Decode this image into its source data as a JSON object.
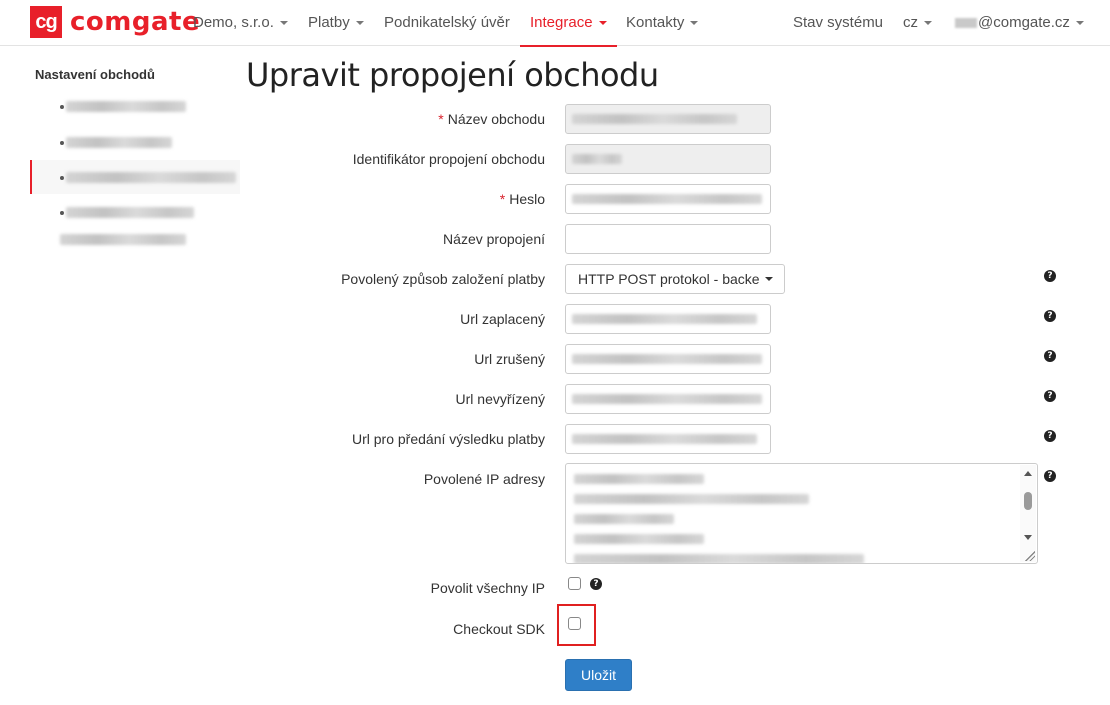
{
  "brand": {
    "logo_mark": "cg",
    "logo_text": "comgate",
    "accent": "#e8202a"
  },
  "navbar": {
    "company": "Demo, s.r.o.",
    "payments": "Platby",
    "loan": "Podnikatelský úvěr",
    "integration": "Integrace",
    "contacts": "Kontakty",
    "system_status": "Stav systému",
    "language": "cz",
    "user_email": "@comgate.cz"
  },
  "sidebar": {
    "title": "Nastavení obchodů"
  },
  "page": {
    "title": "Upravit propojení obchodu"
  },
  "form": {
    "required_mark": "*",
    "shop_name_label": "Název obchodu",
    "connection_id_label": "Identifikátor propojení obchodu",
    "password_label": "Heslo",
    "connection_name_label": "Název propojení",
    "payment_method_label": "Povolený způsob založení platby",
    "payment_method_value": "HTTP POST protokol - backe",
    "url_paid_label": "Url zaplacený",
    "url_cancelled_label": "Url zrušený",
    "url_pending_label": "Url nevyřízený",
    "url_result_label": "Url pro předání výsledku platby",
    "allowed_ip_label": "Povolené IP adresy",
    "allow_all_ip_label": "Povolit všechny IP",
    "checkout_sdk_label": "Checkout SDK",
    "save_label": "Uložit",
    "help_glyph": "?",
    "allow_all_ip_checked": false,
    "checkout_sdk_checked": false
  },
  "colors": {
    "primary_button": "#2f7fc8",
    "required": "#d9232d",
    "highlight": "#e02020"
  }
}
